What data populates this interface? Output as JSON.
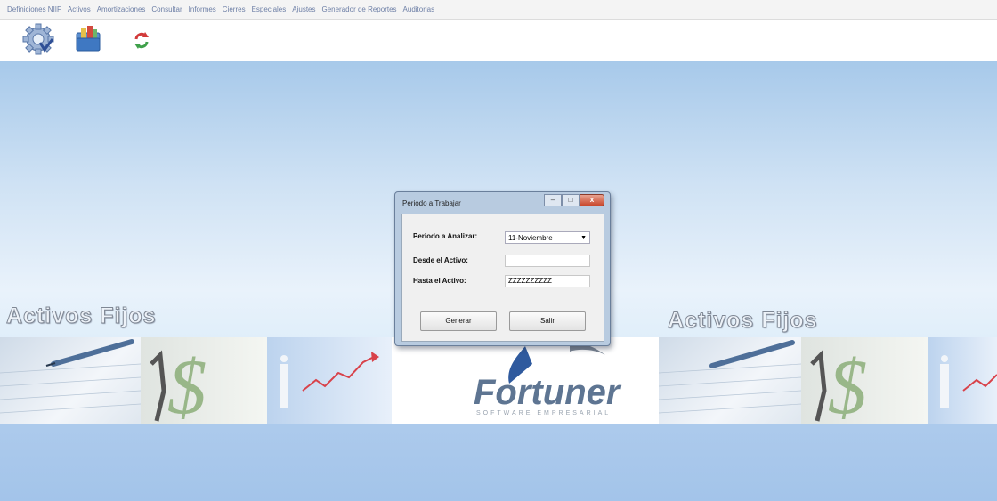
{
  "menu": [
    "Definiciones NIIF",
    "Activos",
    "Amortizaciones",
    "Consultar",
    "Informes",
    "Cierres",
    "Especiales",
    "Ajustes",
    "Generador de Reportes",
    "Auditorias"
  ],
  "toolbar": {
    "buttons": [
      {
        "name": "settings-gear-icon"
      },
      {
        "name": "folder-icon"
      },
      {
        "name": "refresh-icon"
      }
    ]
  },
  "banner": {
    "title_left": "Activos Fijos",
    "title_right": "Activos Fijos",
    "logo_text": "Fortuner",
    "logo_subtitle": "SOFTWARE EMPRESARIAL"
  },
  "dialog": {
    "title": "Periodo a Trabajar",
    "close_label": "x",
    "periodo_label": "Periodo a Analizar:",
    "periodo_value": "11-Noviembre",
    "desde_label": "Desde el Activo:",
    "desde_value": "",
    "hasta_label": "Hasta el Activo:",
    "hasta_value": "ZZZZZZZZZZ",
    "generar_label": "Generar",
    "salir_label": "Salir"
  },
  "colors": {
    "menu_text": "#6d7fa6",
    "desktop_top": "#a7c9ea",
    "desktop_mid": "#e9f2fb",
    "logo_blue": "#2f5a9e",
    "logo_gray": "#7c8694",
    "dollar_green": "#7fa66a",
    "arrow_red": "#d8424a"
  }
}
